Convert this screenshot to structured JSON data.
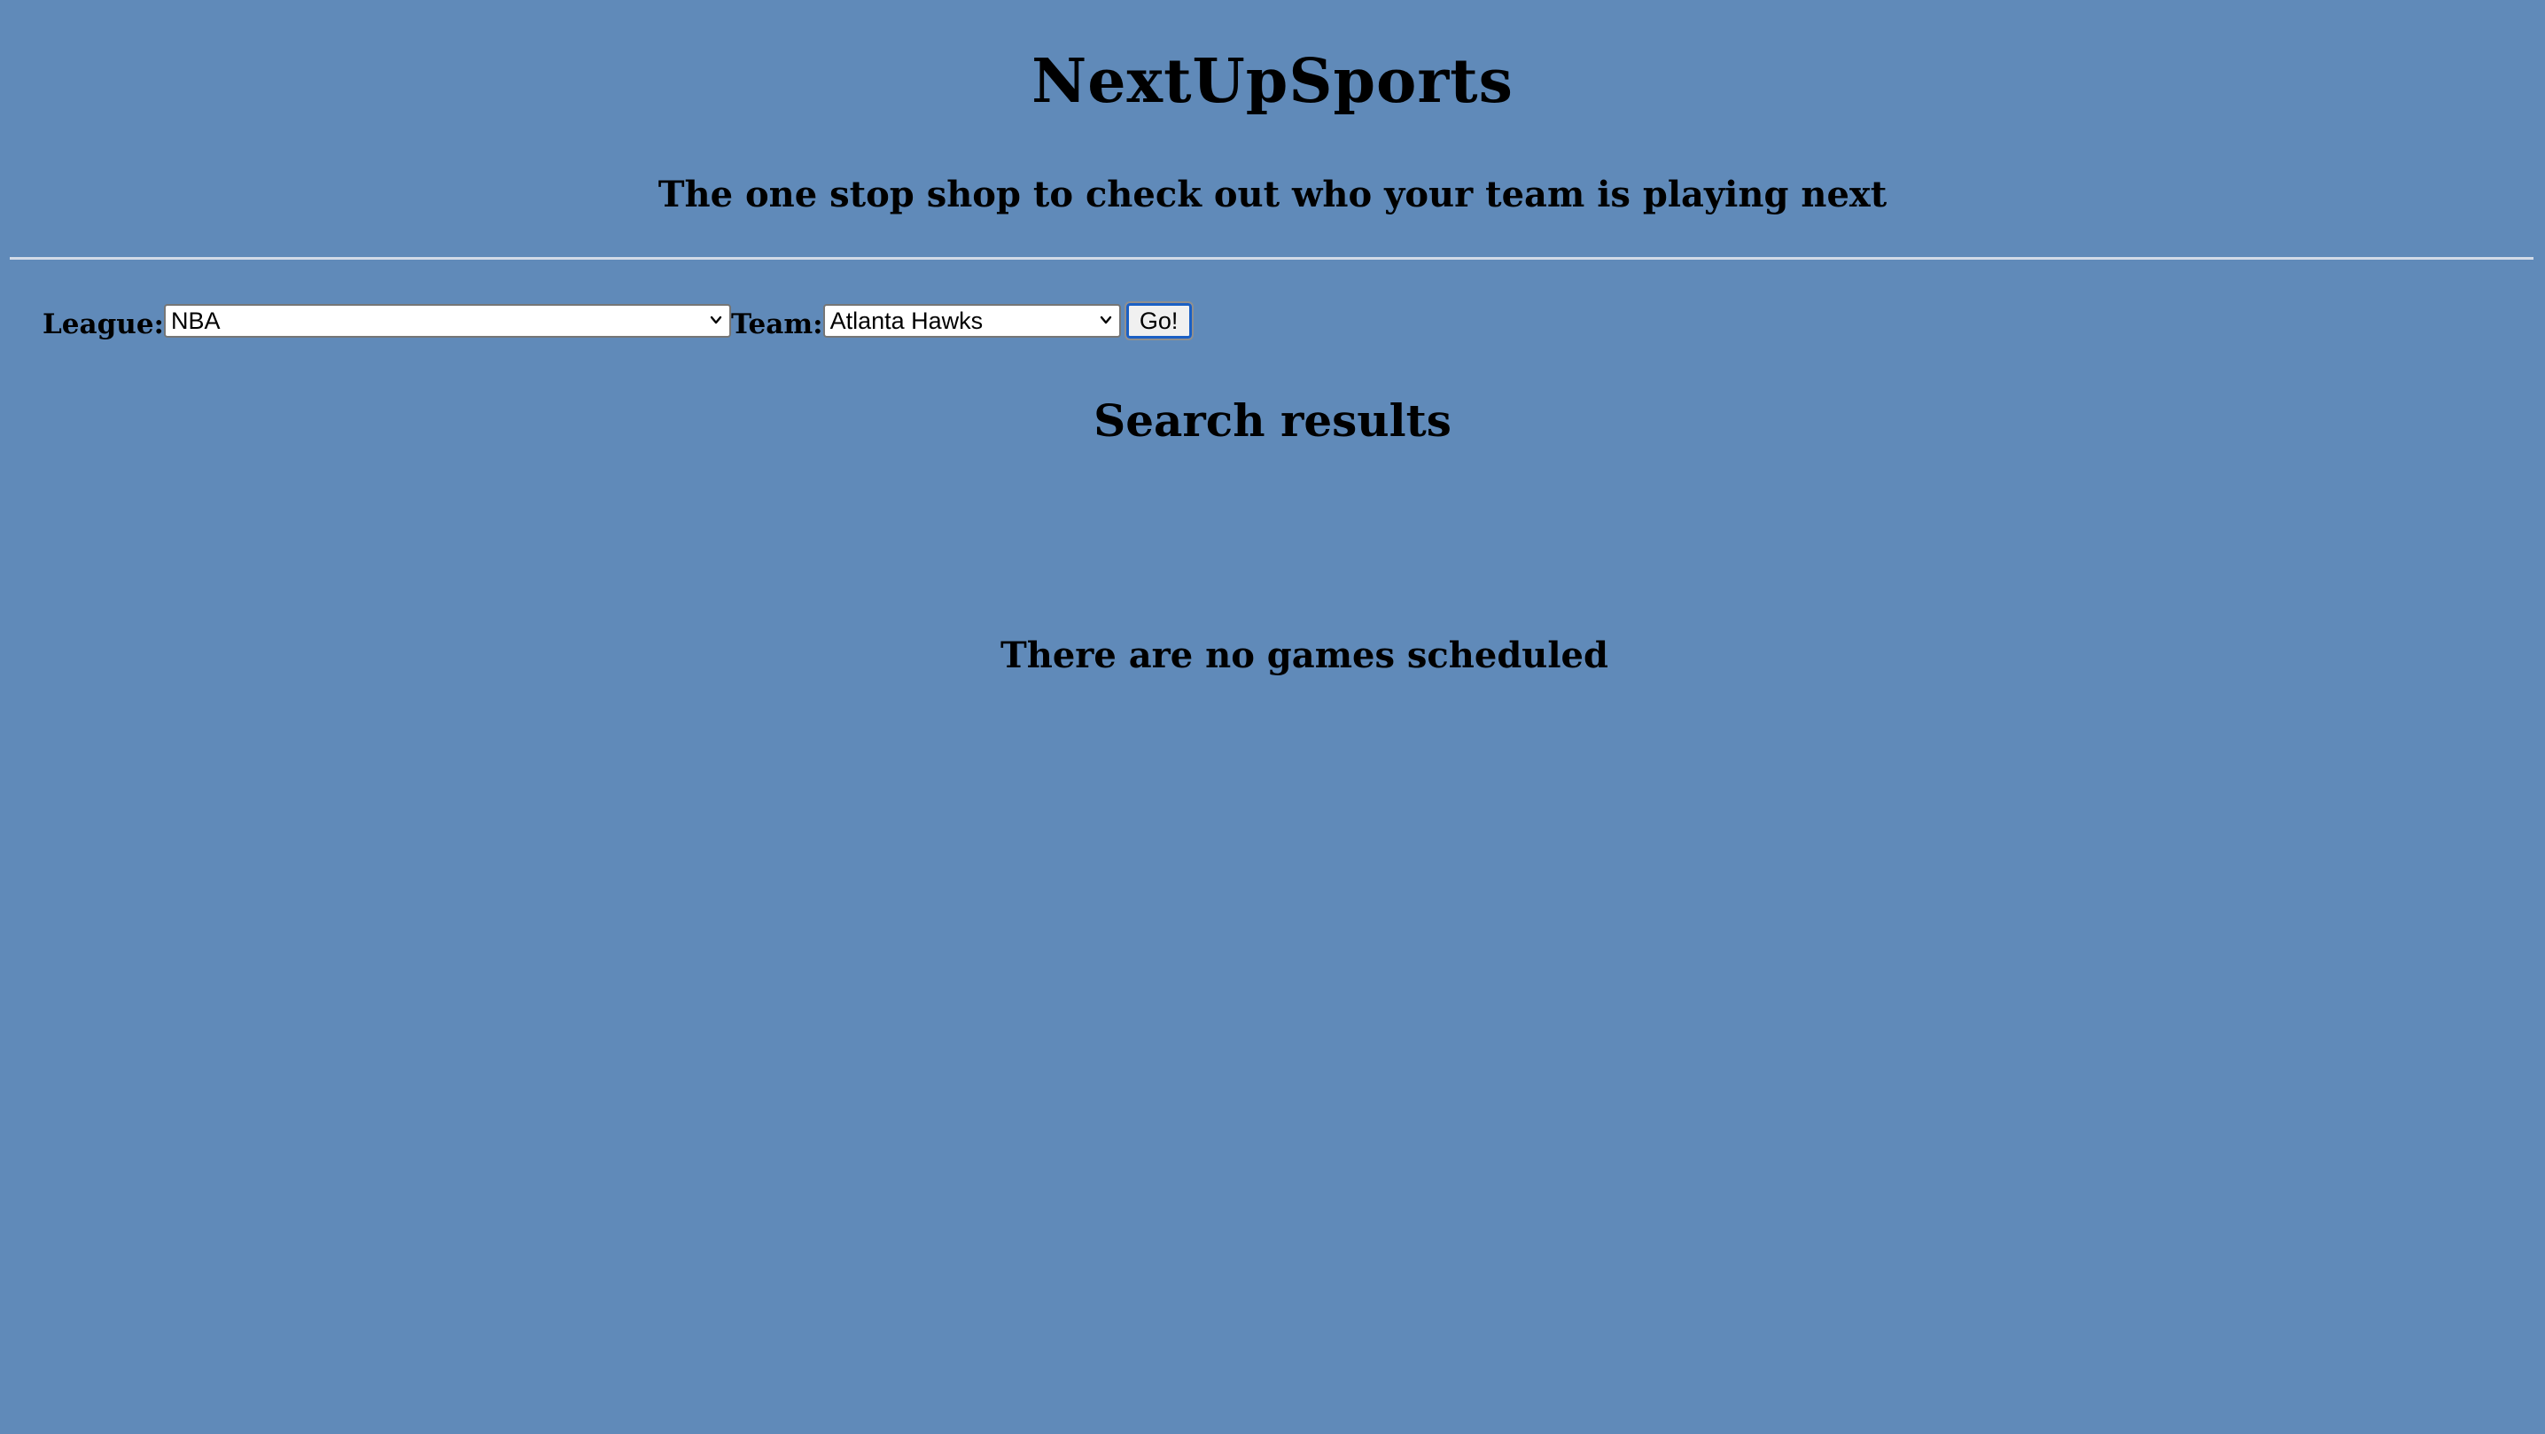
{
  "header": {
    "title": "NextUpSports",
    "tagline": "The one stop shop to check out who your team is playing next"
  },
  "search": {
    "league_label": "League:",
    "league_value": "NBA",
    "team_label": "Team:",
    "team_value": "Atlanta Hawks",
    "go_label": "Go!"
  },
  "results": {
    "heading": "Search results",
    "empty_message": "There are no games scheduled"
  },
  "icons": {
    "dropdown": "chevron-down-icon"
  },
  "colors": {
    "background": "#608ab9",
    "divider": "#d2dbe7",
    "focus_ring": "#1a5fc4"
  }
}
